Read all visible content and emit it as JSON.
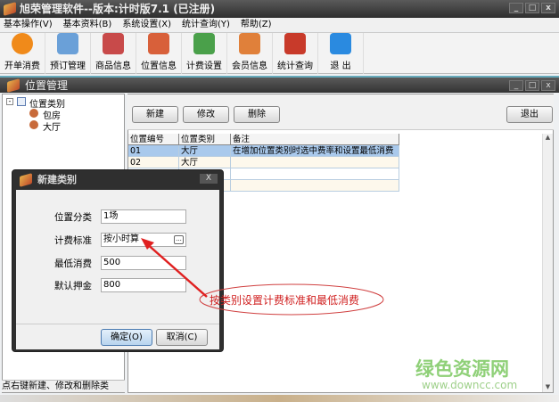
{
  "app": {
    "title": "旭荣管理软件--版本:计时版7.1 (已注册)"
  },
  "menu": [
    "基本操作(V)",
    "基本资料(B)",
    "系统设置(X)",
    "统计查询(Y)",
    "帮助(Z)"
  ],
  "toolbar": [
    {
      "label": "开单消费",
      "icon": "coin-icon",
      "color": "#f08a1a"
    },
    {
      "label": "预订管理",
      "icon": "reservation-icon",
      "color": "#6aa0d8"
    },
    {
      "label": "商品信息",
      "icon": "goods-icon",
      "color": "#c84a4a"
    },
    {
      "label": "位置信息",
      "icon": "location-icon",
      "color": "#d8603a"
    },
    {
      "label": "计费设置",
      "icon": "billing-icon",
      "color": "#4aa04a"
    },
    {
      "label": "会员信息",
      "icon": "members-icon",
      "color": "#e0803a"
    },
    {
      "label": "统计查询",
      "icon": "statistics-icon",
      "color": "#c83a2a"
    },
    {
      "label": "退 出",
      "icon": "exit-icon",
      "color": "#2a8ae0"
    }
  ],
  "window": {
    "title": "位置管理"
  },
  "tree": {
    "root": "位置类别",
    "children": [
      "包房",
      "大厅"
    ]
  },
  "buttons": {
    "new": "新建",
    "edit": "修改",
    "delete": "删除",
    "exit": "退出"
  },
  "grid": {
    "columns": [
      "位置编号",
      "位置类别",
      "备注"
    ],
    "rows": [
      [
        "01",
        "大厅",
        "在增加位置类别时选中费率和设置最低消费"
      ],
      [
        "02",
        "大厅",
        ""
      ],
      [
        "",
        "",
        ""
      ],
      [
        "",
        "",
        ""
      ]
    ]
  },
  "status": "点右键新建、修改和删除类",
  "dialog": {
    "title": "新建类别",
    "fields": [
      {
        "label": "位置分类",
        "value": "1场"
      },
      {
        "label": "计费标准",
        "value": "按小时算"
      },
      {
        "label": "最低消费",
        "value": "500"
      },
      {
        "label": "默认押金",
        "value": "800"
      }
    ],
    "ok": "确定(O)",
    "cancel": "取消(C)",
    "close": "X",
    "ellipsis": "..."
  },
  "annotation": "按类别设置计费标准和最低消费",
  "watermark": {
    "title": "绿色资源网",
    "url": "www.downcc.com"
  }
}
